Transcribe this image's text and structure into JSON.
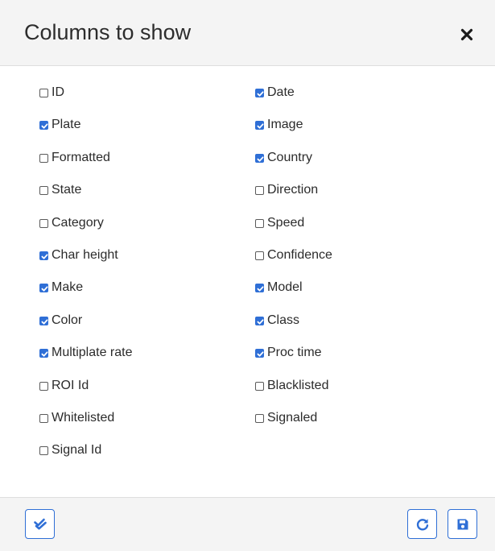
{
  "dialog": {
    "title": "Columns to show",
    "close_icon": "close-icon"
  },
  "columns": {
    "left": [
      {
        "label": "ID",
        "checked": false
      },
      {
        "label": "Plate",
        "checked": true
      },
      {
        "label": "Formatted",
        "checked": false
      },
      {
        "label": "State",
        "checked": false
      },
      {
        "label": "Category",
        "checked": false
      },
      {
        "label": "Char height",
        "checked": true
      },
      {
        "label": "Make",
        "checked": true
      },
      {
        "label": "Color",
        "checked": true
      },
      {
        "label": "Multiplate rate",
        "checked": true
      },
      {
        "label": "ROI Id",
        "checked": false
      },
      {
        "label": "Whitelisted",
        "checked": false
      },
      {
        "label": "Signal Id",
        "checked": false
      }
    ],
    "right": [
      {
        "label": "Date",
        "checked": true
      },
      {
        "label": "Image",
        "checked": true
      },
      {
        "label": "Country",
        "checked": true
      },
      {
        "label": "Direction",
        "checked": false
      },
      {
        "label": "Speed",
        "checked": false
      },
      {
        "label": "Confidence",
        "checked": false
      },
      {
        "label": "Model",
        "checked": true
      },
      {
        "label": "Class",
        "checked": true
      },
      {
        "label": "Proc time",
        "checked": true
      },
      {
        "label": "Blacklisted",
        "checked": false
      },
      {
        "label": "Signaled",
        "checked": false
      }
    ]
  },
  "footer": {
    "select_all_icon": "double-check-icon",
    "reset_icon": "redo-icon",
    "save_icon": "save-icon"
  },
  "colors": {
    "accent": "#2f6fd6",
    "header_bg": "#f4f4f4",
    "text": "#2b2b2b"
  }
}
